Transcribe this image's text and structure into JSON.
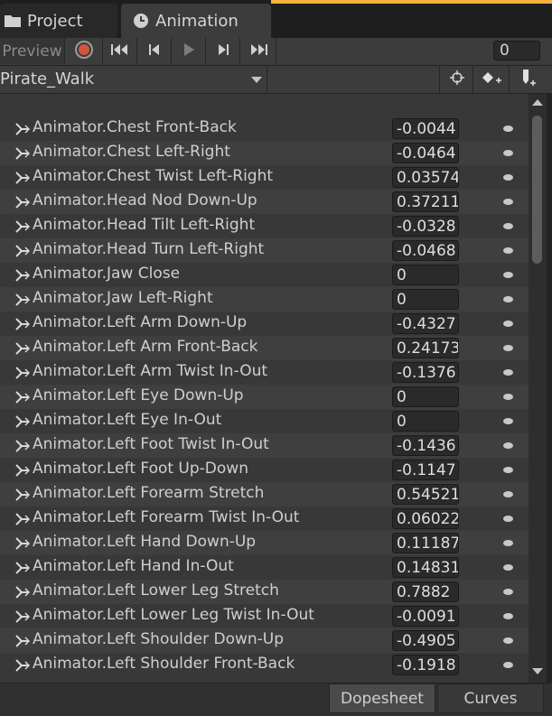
{
  "tabs": [
    {
      "label": "Project",
      "icon": "folder-icon"
    },
    {
      "label": "Animation",
      "icon": "clock-icon"
    }
  ],
  "toolbar": {
    "preview_label": "Preview",
    "frame_value": "0",
    "icons": [
      "record-icon",
      "first-key-icon",
      "prev-key-icon",
      "play-icon",
      "next-key-icon",
      "last-key-icon"
    ]
  },
  "clip": {
    "name": "Pirate_Walk",
    "icons": [
      "filter-by-selection-icon",
      "add-keyframe-icon",
      "add-event-icon"
    ]
  },
  "properties": [
    {
      "label": "Animator.Chest Front-Back",
      "value": "-0.0044"
    },
    {
      "label": "Animator.Chest Left-Right",
      "value": "-0.0464"
    },
    {
      "label": "Animator.Chest Twist Left-Right",
      "value": "0.03574"
    },
    {
      "label": "Animator.Head Nod Down-Up",
      "value": "0.37211"
    },
    {
      "label": "Animator.Head Tilt Left-Right",
      "value": "-0.0328"
    },
    {
      "label": "Animator.Head Turn Left-Right",
      "value": "-0.0468"
    },
    {
      "label": "Animator.Jaw Close",
      "value": "0"
    },
    {
      "label": "Animator.Jaw Left-Right",
      "value": "0"
    },
    {
      "label": "Animator.Left Arm Down-Up",
      "value": "-0.4327"
    },
    {
      "label": "Animator.Left Arm Front-Back",
      "value": "0.24173"
    },
    {
      "label": "Animator.Left Arm Twist In-Out",
      "value": "-0.1376"
    },
    {
      "label": "Animator.Left Eye Down-Up",
      "value": "0"
    },
    {
      "label": "Animator.Left Eye In-Out",
      "value": "0"
    },
    {
      "label": "Animator.Left Foot Twist In-Out",
      "value": "-0.1436"
    },
    {
      "label": "Animator.Left Foot Up-Down",
      "value": "-0.1147"
    },
    {
      "label": "Animator.Left Forearm Stretch",
      "value": "0.54521"
    },
    {
      "label": "Animator.Left Forearm Twist In-Out",
      "value": "0.06022"
    },
    {
      "label": "Animator.Left Hand Down-Up",
      "value": "0.11187"
    },
    {
      "label": "Animator.Left Hand In-Out",
      "value": "0.14831"
    },
    {
      "label": "Animator.Left Lower Leg Stretch",
      "value": "0.7882"
    },
    {
      "label": "Animator.Left Lower Leg Twist In-Out",
      "value": "-0.0091"
    },
    {
      "label": "Animator.Left Shoulder Down-Up",
      "value": "-0.4905"
    },
    {
      "label": "Animator.Left Shoulder Front-Back",
      "value": "-0.1918"
    }
  ],
  "view_tabs": [
    {
      "label": "Dopesheet",
      "selected": true
    },
    {
      "label": "Curves",
      "selected": false
    }
  ],
  "colors": {
    "accent": "#f3b341",
    "record": "#d2563e",
    "background": "#383838"
  }
}
